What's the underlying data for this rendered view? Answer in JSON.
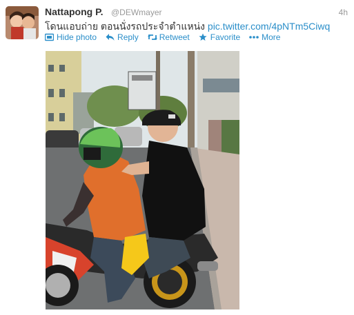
{
  "tweet": {
    "author_name": "Nattapong P.",
    "handle": "@DEWmayer",
    "time": "4h",
    "text": "โดนแอบถ่าย ตอนนั่งรถประจำตำแหน่ง",
    "link": "pic.twitter.com/4pNTm5Ciwq"
  },
  "actions": {
    "hide_photo": "Hide photo",
    "reply": "Reply",
    "retweet": "Retweet",
    "favorite": "Favorite",
    "more": "More"
  },
  "colors": {
    "link": "#2a8ec9",
    "muted": "#999999",
    "text": "#333333"
  }
}
